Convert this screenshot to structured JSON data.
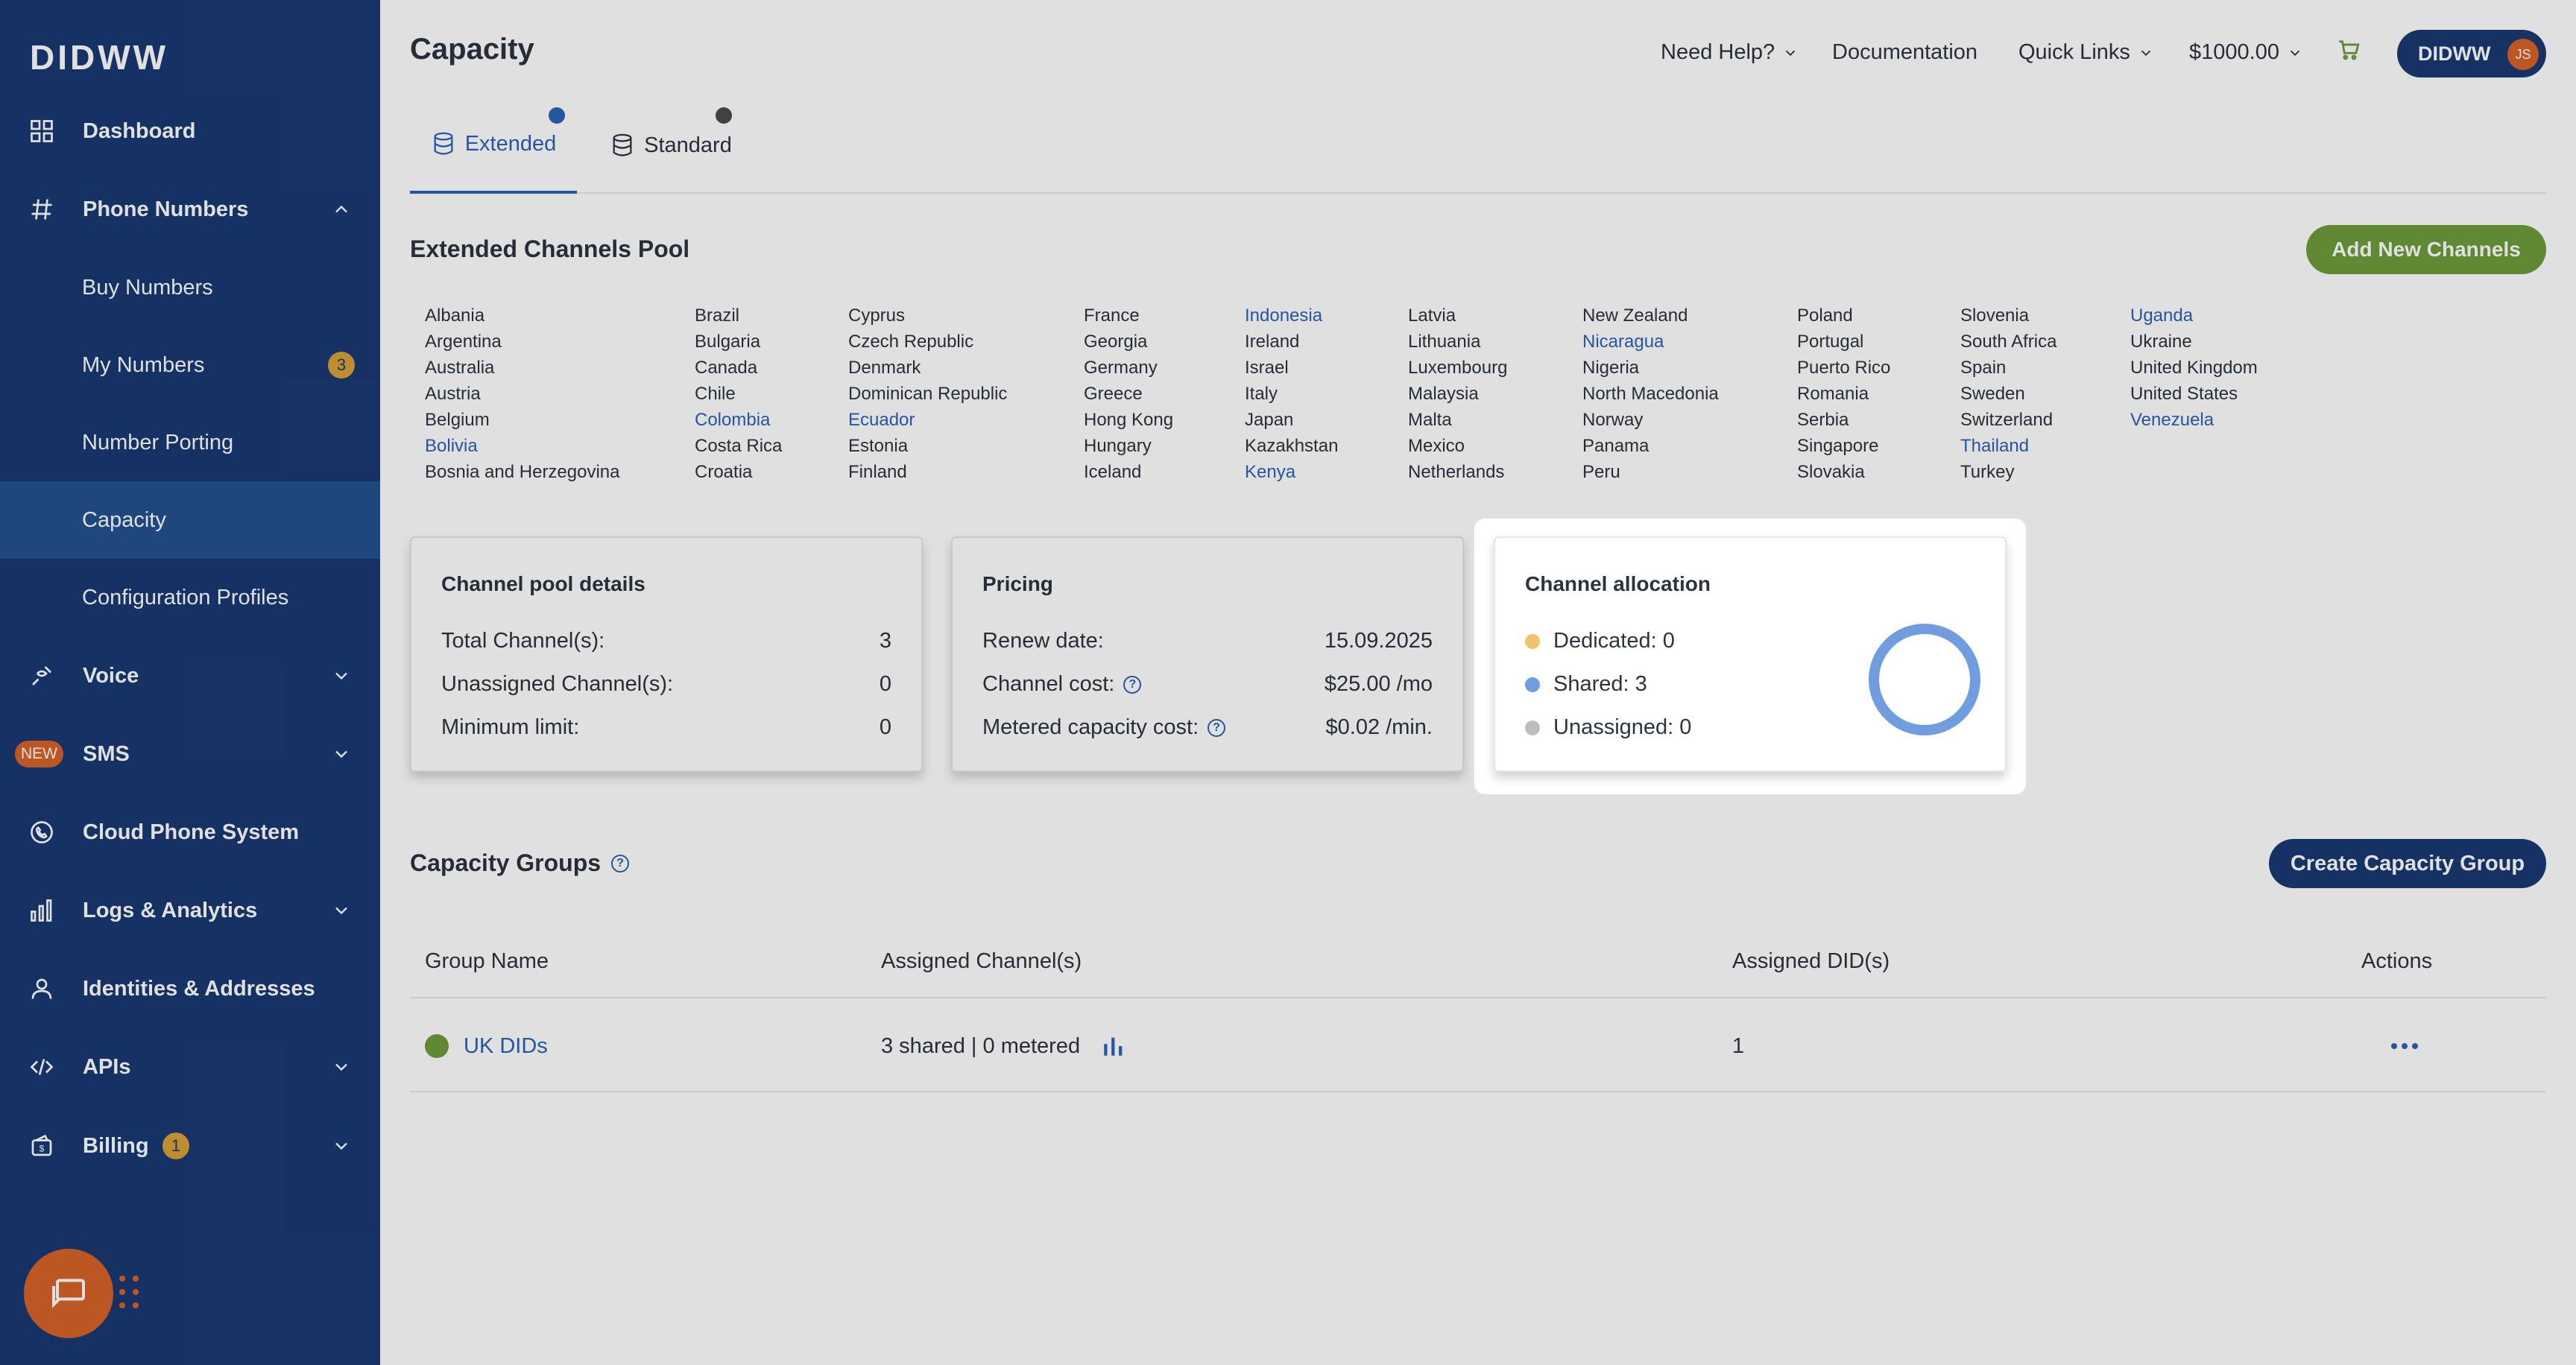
{
  "brand": {
    "logo": "DIDWW",
    "colors": {
      "sidebar": "#1a3a72",
      "accent": "#2a62b8",
      "green": "#6e9b3a",
      "orange": "#d7642a"
    }
  },
  "sidebar": {
    "items": [
      {
        "label": "Dashboard",
        "icon": "grid-icon"
      },
      {
        "label": "Phone Numbers",
        "icon": "hash-icon"
      },
      {
        "label": "Buy Numbers"
      },
      {
        "label": "My Numbers",
        "badge": "3"
      },
      {
        "label": "Number Porting"
      },
      {
        "label": "Capacity"
      },
      {
        "label": "Configuration Profiles"
      },
      {
        "label": "Voice",
        "icon": "voice-icon"
      },
      {
        "label": "SMS",
        "badge": "NEW"
      },
      {
        "label": "Cloud Phone System",
        "icon": "phone-icon"
      },
      {
        "label": "Logs & Analytics",
        "icon": "bar-chart-icon"
      },
      {
        "label": "Identities & Addresses",
        "icon": "user-icon"
      },
      {
        "label": "APIs",
        "icon": "code-icon"
      },
      {
        "label": "Billing",
        "icon": "wallet-icon",
        "badge": "1"
      }
    ]
  },
  "header": {
    "title": "Capacity",
    "need_help": "Need Help?",
    "documentation": "Documentation",
    "quick_links": "Quick Links",
    "balance": "$1000.00",
    "account": "DIDWW",
    "avatar_initials": "JS"
  },
  "tabs": [
    {
      "label": "Extended"
    },
    {
      "label": "Standard"
    }
  ],
  "pool": {
    "title": "Extended Channels Pool",
    "add_button": "Add New Channels",
    "columns": [
      [
        "Albania",
        "Argentina",
        "Australia",
        "Austria",
        "Belgium",
        "Bolivia",
        "Bosnia and Herzegovina"
      ],
      [
        "Brazil",
        "Bulgaria",
        "Canada",
        "Chile",
        "Colombia",
        "Costa Rica",
        "Croatia"
      ],
      [
        "Cyprus",
        "Czech Republic",
        "Denmark",
        "Dominican Republic",
        "Ecuador",
        "Estonia",
        "Finland"
      ],
      [
        "France",
        "Georgia",
        "Germany",
        "Greece",
        "Hong Kong",
        "Hungary",
        "Iceland"
      ],
      [
        "Indonesia",
        "Ireland",
        "Israel",
        "Italy",
        "Japan",
        "Kazakhstan",
        "Kenya"
      ],
      [
        "Latvia",
        "Lithuania",
        "Luxembourg",
        "Malaysia",
        "Malta",
        "Mexico",
        "Netherlands"
      ],
      [
        "New Zealand",
        "Nicaragua",
        "Nigeria",
        "North Macedonia",
        "Norway",
        "Panama",
        "Peru"
      ],
      [
        "Poland",
        "Portugal",
        "Puerto Rico",
        "Romania",
        "Serbia",
        "Singapore",
        "Slovakia"
      ],
      [
        "Slovenia",
        "South Africa",
        "Spain",
        "Sweden",
        "Switzerland",
        "Thailand",
        "Turkey"
      ],
      [
        "Uganda",
        "Ukraine",
        "United Kingdom",
        "United States",
        "Venezuela"
      ]
    ],
    "links": [
      "Bolivia",
      "Colombia",
      "Ecuador",
      "Indonesia",
      "Kenya",
      "Nicaragua",
      "Thailand",
      "Uganda",
      "Venezuela"
    ]
  },
  "pool_details": {
    "title": "Channel pool details",
    "rows": [
      {
        "label": "Total Channel(s):",
        "value": "3"
      },
      {
        "label": "Unassigned Channel(s):",
        "value": "0"
      },
      {
        "label": "Minimum limit:",
        "value": "0"
      }
    ]
  },
  "pricing": {
    "title": "Pricing",
    "rows": [
      {
        "label": "Renew date:",
        "value": "15.09.2025"
      },
      {
        "label": "Channel cost:",
        "value": "$25.00 /mo"
      },
      {
        "label": "Metered capacity cost:",
        "value": "$0.02 /min."
      }
    ]
  },
  "allocation": {
    "title": "Channel allocation",
    "legend": [
      {
        "label": "Dedicated: 0",
        "color": "#f2c36b"
      },
      {
        "label": "Shared: 3",
        "color": "#6f9de0"
      },
      {
        "label": "Unassigned: 0",
        "color": "#bdbdbd"
      }
    ],
    "chart": {
      "dedicated": 0,
      "shared": 3,
      "unassigned": 0
    }
  },
  "groups": {
    "title": "Capacity Groups",
    "create_button": "Create Capacity Group",
    "columns": [
      "Group Name",
      "Assigned Channel(s)",
      "Assigned DID(s)",
      "Actions"
    ],
    "rows": [
      {
        "name": "UK DIDs",
        "channels": "3 shared | 0 metered",
        "dids": "1",
        "status_color": "#6e9b3a"
      }
    ]
  }
}
